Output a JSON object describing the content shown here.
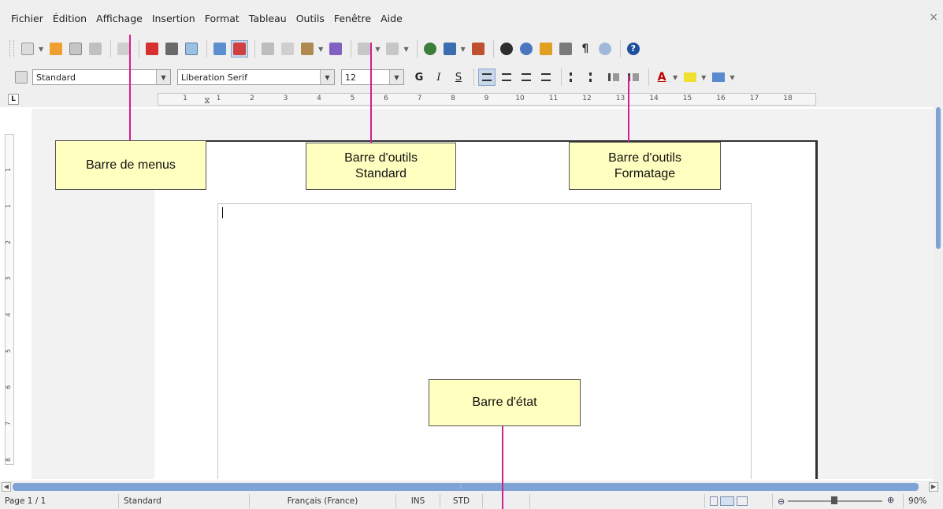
{
  "menubar": {
    "items": [
      "Fichier",
      "Édition",
      "Affichage",
      "Insertion",
      "Format",
      "Tableau",
      "Outils",
      "Fenêtre",
      "Aide"
    ],
    "close_glyph": "×"
  },
  "toolbar_standard": {
    "icons": [
      "new-document-icon",
      "open-icon",
      "save-icon",
      "email-icon",
      "edit-file-icon",
      "export-pdf-icon",
      "print-icon",
      "print-preview-icon",
      "spellcheck-icon",
      "autospellcheck-icon",
      "cut-icon",
      "copy-icon",
      "paste-icon",
      "clone-formatting-icon",
      "undo-icon",
      "redo-icon",
      "hyperlink-icon",
      "table-icon",
      "chart-icon",
      "find-replace-icon",
      "navigator-icon",
      "gallery-icon",
      "data-sources-icon",
      "formatting-marks-icon",
      "zoom-icon",
      "help-icon"
    ]
  },
  "toolbar_formatting": {
    "paragraph_style": "Standard",
    "font_name": "Liberation Serif",
    "font_size": "12",
    "bold_label": "G",
    "italic_label": "I",
    "underline_label": "S"
  },
  "ruler": {
    "ticks": [
      "1",
      "1",
      "2",
      "3",
      "4",
      "5",
      "6",
      "7",
      "8",
      "9",
      "10",
      "11",
      "12",
      "13",
      "14",
      "15",
      "16",
      "17",
      "18"
    ]
  },
  "vruler": {
    "ticks": [
      "1",
      "1",
      "2",
      "3",
      "4",
      "5",
      "6",
      "7",
      "8"
    ]
  },
  "statusbar": {
    "page": "Page 1 / 1",
    "style": "Standard",
    "language": "Français (France)",
    "insert_mode": "INS",
    "selection_mode": "STD",
    "zoom": "90%"
  },
  "callouts": {
    "menubar": "Barre de menus",
    "standard_toolbar_line1": "Barre d'outils",
    "standard_toolbar_line2": "Standard",
    "formatting_toolbar_line1": "Barre d'outils",
    "formatting_toolbar_line2": "Formatage",
    "statusbar": "Barre d'état"
  },
  "colors": {
    "callout_bg": "#ffffc0",
    "callout_line": "#d02090",
    "scroll_thumb": "#7fa3d4"
  }
}
